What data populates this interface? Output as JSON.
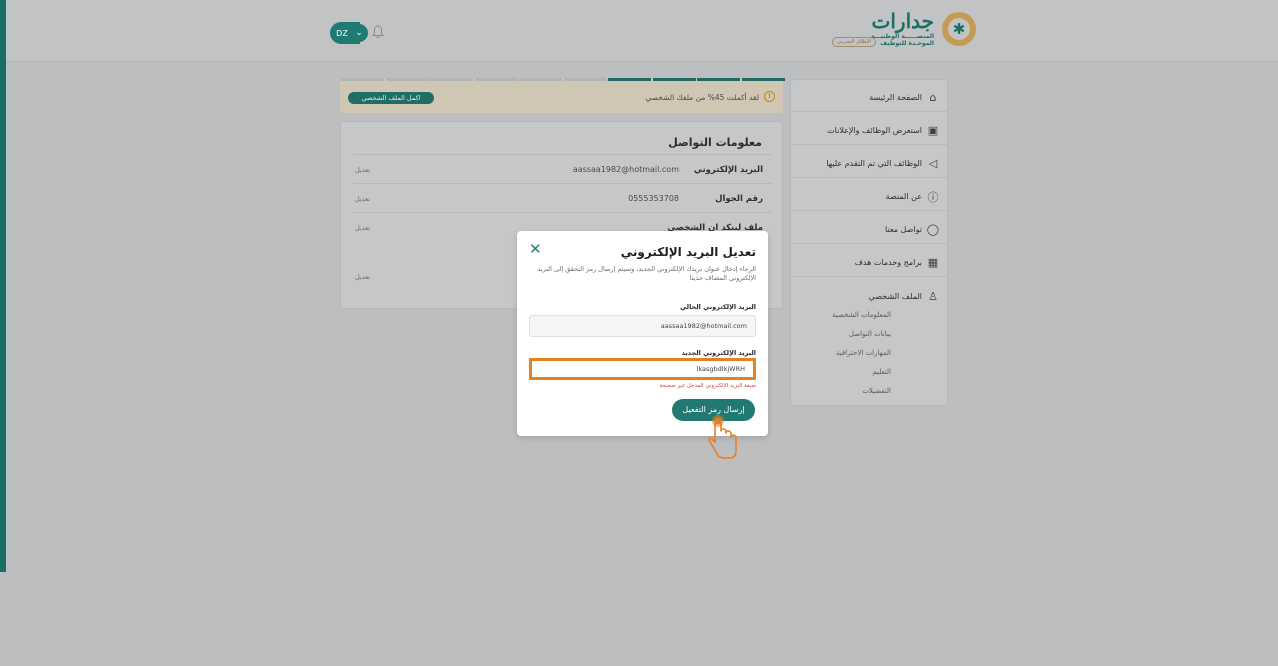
{
  "header": {
    "avatar_initials": "DZ",
    "avatar_chevron": "⌄",
    "bell_icon": "bell-icon",
    "logo": {
      "name": "جدارات",
      "subtitle_line1": "المنصــــــة الوطنيـــة",
      "subtitle_line2": "الموحـدة للتوظيف",
      "beta_badge": "الإطلاق التجريبي"
    }
  },
  "sidebar": {
    "items": [
      {
        "label": "الصفحة الرئيسة",
        "icon": "home-icon"
      },
      {
        "label": "استعرض الوظائف والإعلانات",
        "icon": "briefcase-icon"
      },
      {
        "label": "الوظائف التي تم التقدم عليها",
        "icon": "send-icon"
      },
      {
        "label": "عن المنصة",
        "icon": "info-icon"
      },
      {
        "label": "تواصل معنا",
        "icon": "chat-icon"
      },
      {
        "label": "برامج وخدمات هدف",
        "icon": "grid-icon"
      },
      {
        "label": "الملف الشخصي",
        "icon": "user-icon"
      }
    ],
    "sub_items": [
      "المعلومات الشخصية",
      "بيانات التواصل",
      "المهارات الاحترافية",
      "التعليم",
      "التفضيلات"
    ]
  },
  "progress": {
    "text": "لقد أكملت 45% من ملفك الشخصي",
    "percent": 45,
    "segments_total": 10,
    "segments_done": 4,
    "button_label": "اكمل الملف الشخصي",
    "warning_glyph": "!"
  },
  "contact": {
    "title": "معلومات التواصل",
    "rows": [
      {
        "label": "البريد الإلكتروني",
        "value": "aassaa1982@hotmail.com",
        "action": "تعديل"
      },
      {
        "label": "رقم الجوال",
        "value": "0555353708",
        "action": "تعديل"
      },
      {
        "label": "ملف لينكد ان الشخصي",
        "value": "",
        "action": "تعديل"
      },
      {
        "label": "",
        "value": "",
        "action": "تعديل"
      }
    ]
  },
  "modal": {
    "title": "تعديل البريد الإلكتروني",
    "close_glyph": "✕",
    "description": "الرجاء إدخال عنوان بريدك الإلكتروني الجديد، وسيتم إرسال رمز التحقق إلى البريد الإلكتروني المضاف حديثا",
    "current_label": "البريد الإلكتروني الحالي",
    "current_value": "aassaa1982@hotmail.com",
    "new_label": "البريد الإلكتروني الجديد",
    "new_value": "lkasgbdlkjWRH",
    "error_text": "صيغة البريد الإلكتروني المدخل غير صحيحة",
    "send_label": "إرسال رمز التفعيل"
  },
  "colors": {
    "primary": "#217a72",
    "highlight": "#e58023",
    "error": "#d04646",
    "warning": "#c08a14"
  }
}
